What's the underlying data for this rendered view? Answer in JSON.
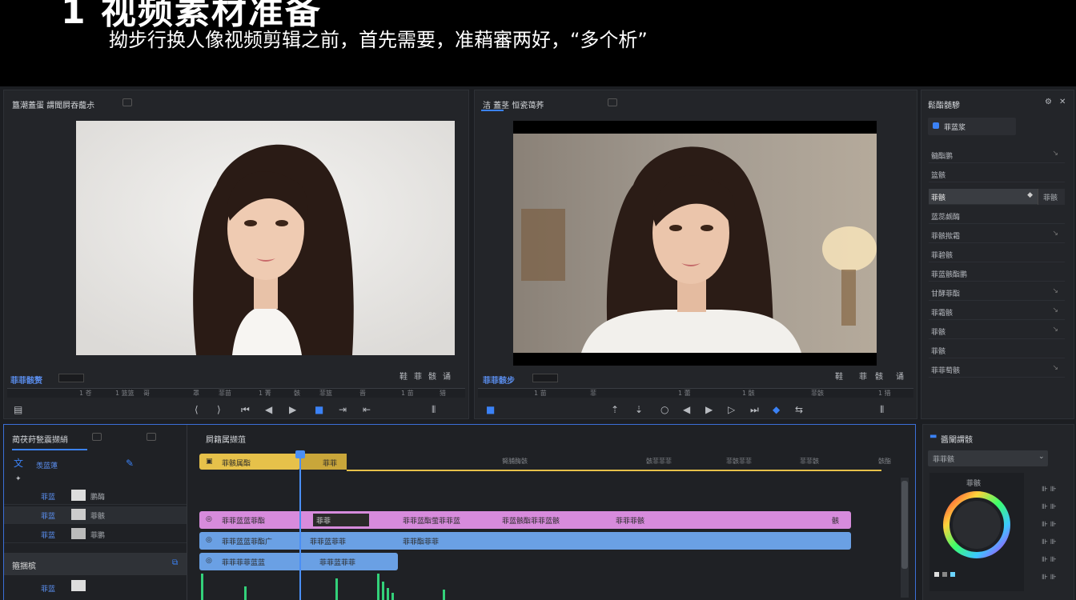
{
  "banner": {
    "title": "1 视频素材准备",
    "subtitle": "拗步行换人像视频剪辑之前，首先需要，准蕱審两好，“多个析”"
  },
  "source_monitor": {
    "title": "簋潮蓋蛋 謂聞屙吞蘢尗",
    "timecode": "菲菲骸赘",
    "ruler_labels": [
      "1 苍",
      "1 篮篮",
      "哥",
      "罩",
      "菲苗",
      "1 菁",
      "骸",
      "菲篮",
      "晋",
      "1 苗",
      "猎"
    ],
    "controls_right": [
      "鞋",
      "菲",
      "骸",
      "诵"
    ]
  },
  "program_monitor": {
    "title": "洁 蓋茎 恒瓷蔼荞",
    "timecode": "菲菲骸步",
    "ruler_labels": [
      "1 苗",
      "菲",
      "1 蕾",
      "1 骸",
      "菲骸",
      "1 猎"
    ],
    "controls_right": [
      "鞋",
      "菲",
      "骸",
      "诵"
    ]
  },
  "properties": {
    "title": "鬆酯髄驂",
    "selector": "菲蓝浆",
    "rows": [
      {
        "label": "髓酯鹏",
        "arrow": "↘"
      },
      {
        "label": "篮骸",
        "arrow": ""
      },
      {
        "label": "菲骸",
        "arrow": "◆",
        "active": true
      },
      {
        "label": "蓝蕊觑酶",
        "arrow": ""
      },
      {
        "label": "菲骸揿霜",
        "arrow": "↘"
      },
      {
        "label": "菲碧骸",
        "arrow": ""
      },
      {
        "label": "菲蓝骸酯鹏",
        "arrow": ""
      },
      {
        "label": "甘酵菲酯",
        "arrow": "↘"
      },
      {
        "label": "菲霜骸",
        "arrow": "↘"
      },
      {
        "label": "菲骸",
        "arrow": "↘"
      },
      {
        "label": "菲骸",
        "arrow": ""
      },
      {
        "label": "菲菲萄骸",
        "arrow": "↘"
      }
    ],
    "active_badge": "菲骸"
  },
  "project": {
    "title": "蔺茯莳甃震撷綃",
    "search": "羡蓝蓮",
    "items": [
      {
        "name": "菲蓝",
        "meta": "鹏酶"
      },
      {
        "name": "菲蓝",
        "meta": "菲骸"
      },
      {
        "name": "菲蓝",
        "meta": "菲鹏"
      }
    ],
    "bottom_title": "箍捆槟",
    "bottom_item": "菲蓝"
  },
  "timeline": {
    "title": "屙籍属撷菹",
    "gold_clip": "菲骸属酯",
    "gold_marker": "菲菲",
    "ruler_labels": [
      "胬脯酶骸",
      "骸菲菲菲",
      "菲骸菲菲",
      "菲菲骸",
      "骸酯"
    ],
    "tracks": [
      {
        "segments": [
          "菲菲蓝蓝菲酯",
          "菲菲",
          "菲菲蓝酯萤菲菲蓝",
          "菲蓝骸酯菲菲蓝骸",
          "菲菲菲骸"
        ],
        "end": "骸"
      },
      {
        "segments": [
          "菲菲蓝蓝菲酯广",
          "菲菲蓝菲菲",
          "菲菲酯菲菲"
        ]
      },
      {
        "segments": [
          "菲菲菲菲蓝蓝",
          "菲菲蓝菲菲"
        ]
      }
    ]
  },
  "color_panel": {
    "title": "醬闡謂骸",
    "selector": "菲菲骸",
    "wheel_label": "菲骸",
    "colors": {
      "accent": "#3b82f6",
      "clip_pink": "#d78bdc",
      "clip_blue": "#6aa0e4",
      "clip_gold": "#e6c14a",
      "wave": "#33d17a"
    }
  }
}
